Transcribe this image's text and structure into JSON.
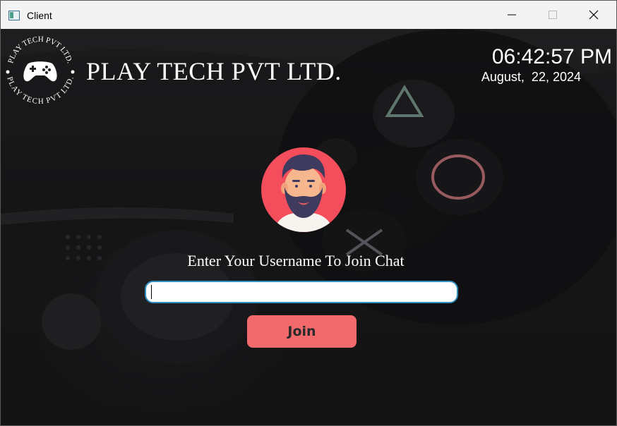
{
  "window": {
    "title": "Client"
  },
  "brand": {
    "company_name": "PLAY TECH PVT LTD.",
    "logo_ring_text": "PLAY TECH PVT LTD."
  },
  "clock": {
    "time": "06:42:57 PM",
    "date": "August,  22, 2024"
  },
  "login": {
    "prompt": "Enter Your Username To Join Chat",
    "username_value": "",
    "join_label": "Join"
  },
  "colors": {
    "join_button": "#f26a6b",
    "input_border": "#2f8fc0",
    "avatar_bg": "#f44d5b",
    "text": "#ffffff"
  },
  "icons": {
    "app": "window-app-icon",
    "logo": "gamepad-icon",
    "avatar": "bearded-man-avatar",
    "minimize": "minimize-icon",
    "maximize": "maximize-icon",
    "close": "close-icon"
  }
}
